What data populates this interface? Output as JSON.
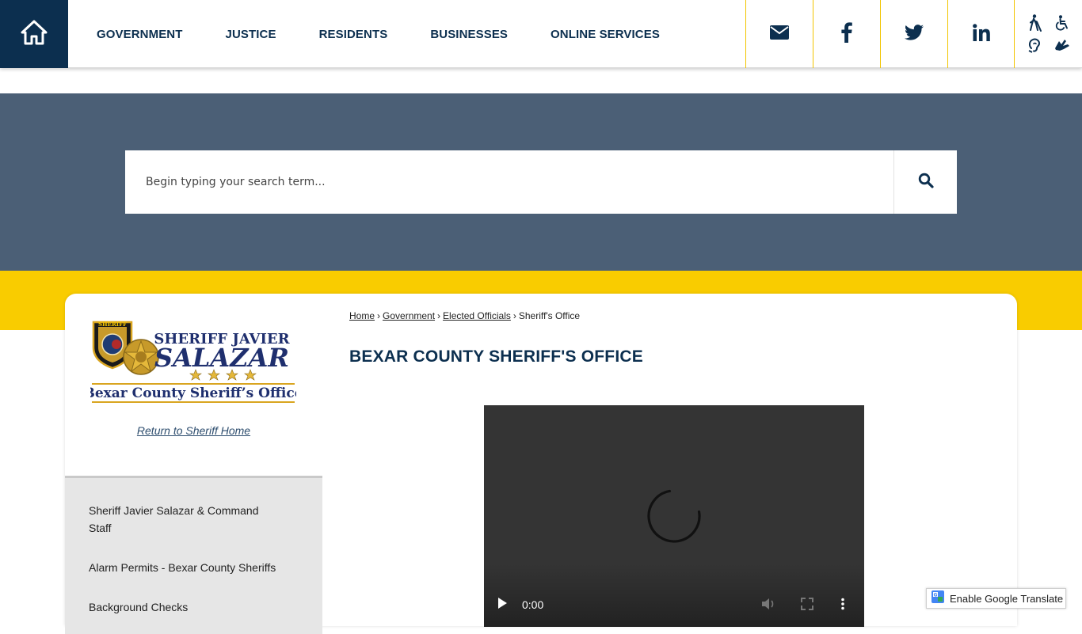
{
  "nav": {
    "home_icon": "home-icon",
    "items": [
      {
        "label": "GOVERNMENT"
      },
      {
        "label": "JUSTICE"
      },
      {
        "label": "RESIDENTS"
      },
      {
        "label": "BUSINESSES"
      },
      {
        "label": "ONLINE SERVICES"
      }
    ]
  },
  "social": {
    "icons": [
      "mail-icon",
      "facebook-icon",
      "twitter-icon",
      "linkedin-icon"
    ]
  },
  "accessibility": {
    "icons": [
      "blind-walking-icon",
      "wheelchair-icon",
      "hearing-icon",
      "sign-language-icon"
    ]
  },
  "search": {
    "placeholder": "Begin typing your search term..."
  },
  "logo": {
    "line1": "SHERIFF JAVIER",
    "line2": "SALAZAR",
    "line3": "Bexar County Sheriff’s Office",
    "badge_text": "SHERIFF"
  },
  "sidebar": {
    "return_link": "Return to Sheriff Home",
    "items": [
      {
        "label": "Sheriff Javier Salazar & Command Staff"
      },
      {
        "label": "Alarm Permits - Bexar County Sheriffs"
      },
      {
        "label": "Background Checks"
      }
    ]
  },
  "breadcrumb": {
    "items": [
      "Home",
      "Government",
      "Elected Officials"
    ],
    "current": "Sheriff's Office",
    "separator": "›"
  },
  "page": {
    "title": "BEXAR COUNTY SHERIFF'S OFFICE"
  },
  "video": {
    "time": "0:00"
  },
  "translate": {
    "label": "Enable Google Translate"
  },
  "colors": {
    "navy": "#0c2f4f",
    "slate": "#4b5f76",
    "yellow": "#f9cc00",
    "gold": "#d9a520"
  }
}
